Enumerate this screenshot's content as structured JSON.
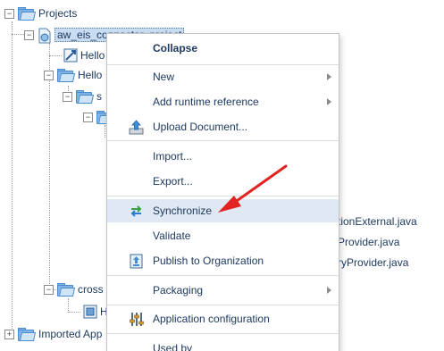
{
  "tree": {
    "projects_label": "Projects",
    "project_label": "aw_eis_connector_project",
    "hello_label_1": "Hello",
    "hello_label_2": "Hello",
    "s_label": "s",
    "cross_label": "cross",
    "h_label": "H",
    "imported_label": "Imported App"
  },
  "background_files": {
    "file_1": "tionExternal.java",
    "file_2": "Provider.java",
    "file_3": "ryProvider.java"
  },
  "menu": {
    "collapse": "Collapse",
    "new": "New",
    "add_runtime_reference": "Add runtime reference",
    "upload_document": "Upload Document...",
    "import": "Import...",
    "export": "Export...",
    "synchronize": "Synchronize",
    "validate": "Validate",
    "publish": "Publish to Organization",
    "packaging": "Packaging",
    "application_configuration": "Application configuration",
    "used_by": "Used by"
  },
  "colors": {
    "menu_highlight": "#dfe8f3",
    "annotation_arrow": "#e32222",
    "selection": "#c8dcf2"
  }
}
